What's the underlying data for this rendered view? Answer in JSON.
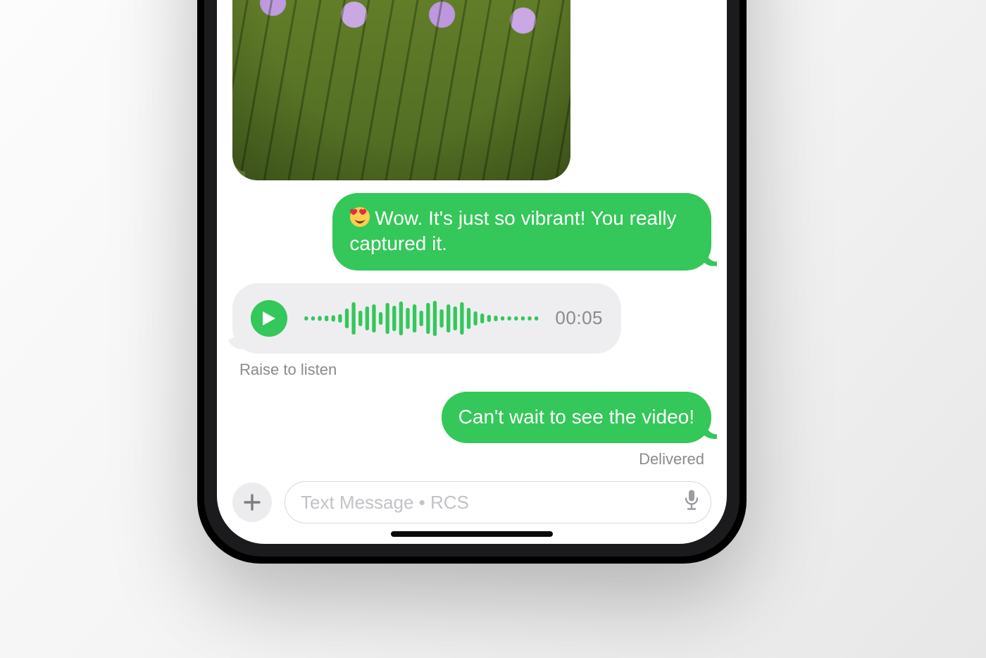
{
  "colors": {
    "sms_green": "#34c759",
    "bubble_grey": "#eeeef0",
    "secondary_text": "#8a8a8f",
    "input_border": "#d9d9de",
    "plus_bg": "#ececee"
  },
  "conversation": {
    "image_message": {
      "side": "incoming",
      "content_description": "photo-lavender-flowers"
    },
    "reply_1": {
      "side": "outgoing",
      "emoji_name": "heart-eyes-emoji",
      "text": "Wow. It's just so vibrant! You really captured it."
    },
    "audio_message": {
      "side": "incoming",
      "play_icon": "play-icon",
      "duration": "00:05",
      "hint": "Raise to listen",
      "waveform_heights": [
        6,
        6,
        7,
        8,
        9,
        12,
        28,
        46,
        22,
        34,
        40,
        18,
        44,
        36,
        48,
        30,
        40,
        22,
        44,
        50,
        26,
        40,
        34,
        46,
        30,
        20,
        14,
        10,
        8,
        6,
        6,
        6,
        6,
        6,
        6
      ]
    },
    "reply_2": {
      "side": "outgoing",
      "text": "Can't wait to see the video!",
      "status": "Delivered"
    }
  },
  "composer": {
    "plus_icon": "plus-icon",
    "placeholder": "Text Message • RCS",
    "mic_icon": "microphone-icon"
  },
  "home_indicator": "home-indicator"
}
